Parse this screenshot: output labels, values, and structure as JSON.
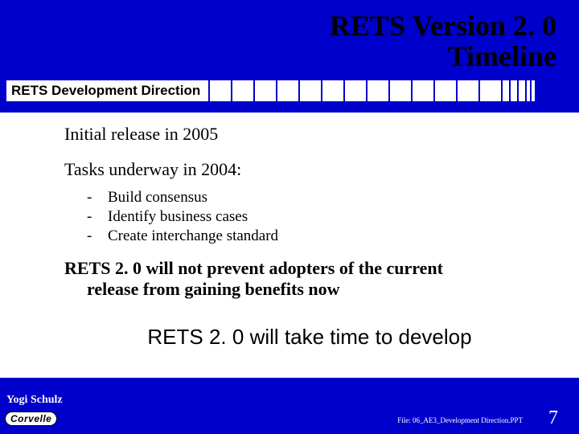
{
  "title_line1": "RETS Version 2. 0",
  "title_line2": "Timeline",
  "subtitle": "RETS Development Direction",
  "bullets": {
    "b1": "Initial release in 2005",
    "b2": "Tasks underway in 2004:",
    "sub": [
      "Build consensus",
      "Identify business cases",
      "Create interchange standard"
    ],
    "b3a": "RETS 2. 0 will not prevent adopters of the current",
    "b3b": "release from gaining benefits now"
  },
  "callout": "RETS 2. 0 will take time to develop",
  "author": "Yogi Schulz",
  "logo": "Corvelle",
  "file_label": "File: 06_AE3_Development Direction.PPT",
  "page_number": "7"
}
